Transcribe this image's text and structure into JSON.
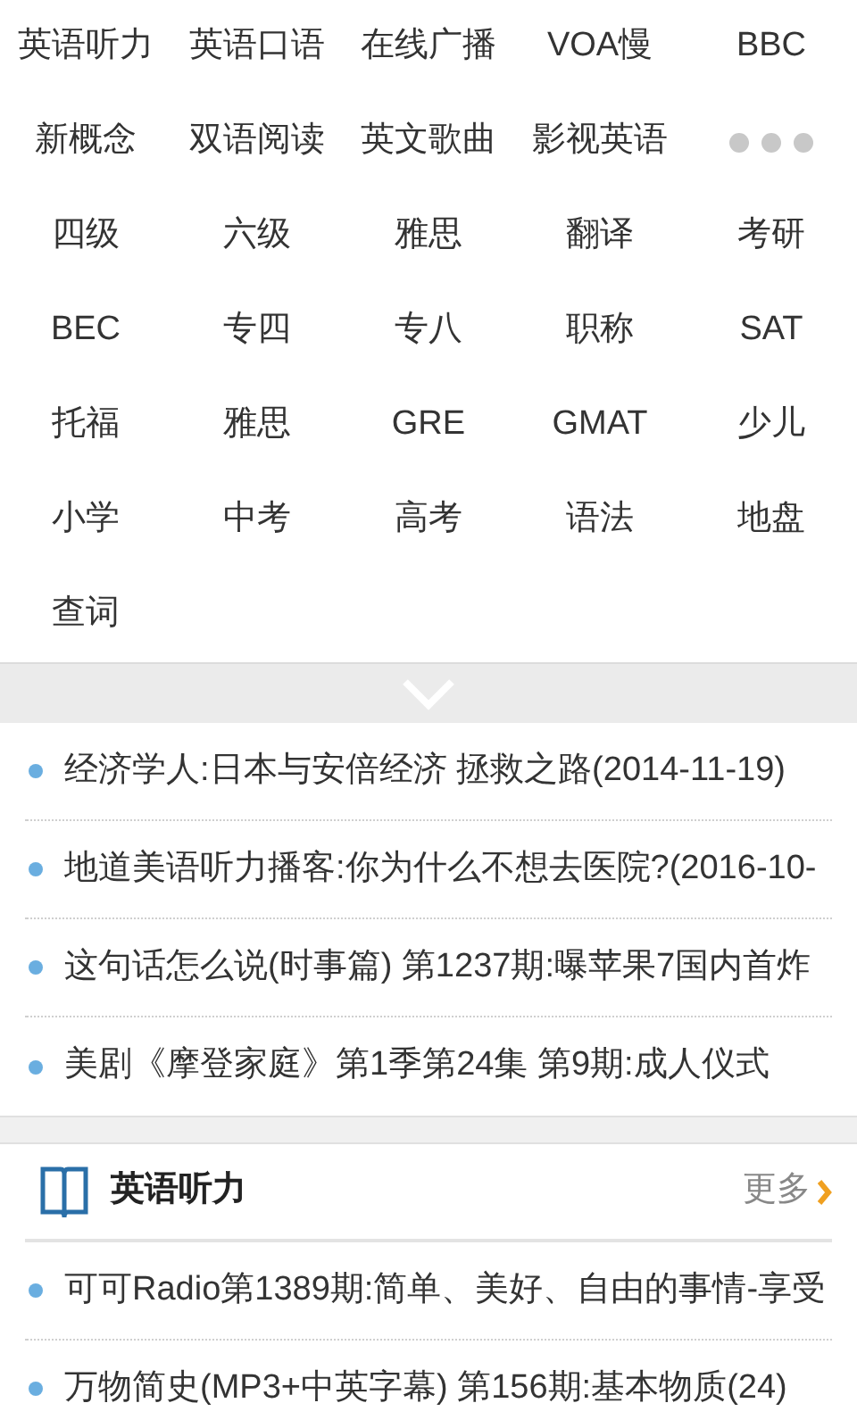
{
  "categories": [
    {
      "kind": "link",
      "label": "英语听力"
    },
    {
      "kind": "link",
      "label": "英语口语"
    },
    {
      "kind": "link",
      "label": "在线广播"
    },
    {
      "kind": "link",
      "label": "VOA慢"
    },
    {
      "kind": "link",
      "label": "BBC"
    },
    {
      "kind": "link",
      "label": "新概念"
    },
    {
      "kind": "link",
      "label": "双语阅读"
    },
    {
      "kind": "link",
      "label": "英文歌曲"
    },
    {
      "kind": "link",
      "label": "影视英语"
    },
    {
      "kind": "more"
    },
    {
      "kind": "link",
      "label": "四级"
    },
    {
      "kind": "link",
      "label": "六级"
    },
    {
      "kind": "link",
      "label": "雅思"
    },
    {
      "kind": "link",
      "label": "翻译"
    },
    {
      "kind": "link",
      "label": "考研"
    },
    {
      "kind": "link",
      "label": "BEC"
    },
    {
      "kind": "link",
      "label": "专四"
    },
    {
      "kind": "link",
      "label": "专八"
    },
    {
      "kind": "link",
      "label": "职称"
    },
    {
      "kind": "link",
      "label": "SAT"
    },
    {
      "kind": "link",
      "label": "托福"
    },
    {
      "kind": "link",
      "label": "雅思"
    },
    {
      "kind": "link",
      "label": "GRE"
    },
    {
      "kind": "link",
      "label": "GMAT"
    },
    {
      "kind": "link",
      "label": "少儿"
    },
    {
      "kind": "link",
      "label": "小学"
    },
    {
      "kind": "link",
      "label": "中考"
    },
    {
      "kind": "link",
      "label": "高考"
    },
    {
      "kind": "link",
      "label": "语法"
    },
    {
      "kind": "link",
      "label": "地盘"
    },
    {
      "kind": "link",
      "label": "查词"
    }
  ],
  "top_articles": [
    "经济学人:日本与安倍经济 拯救之路(2014-11-19)",
    "地道美语听力播客:你为什么不想去医院?(2016-10-",
    "这句话怎么说(时事篇) 第1237期:曝苹果7国内首炸",
    "美剧《摩登家庭》第1季第24集 第9期:成人仪式"
  ],
  "section": {
    "title": "英语听力",
    "more": "更多",
    "articles": [
      "可可Radio第1389期:简单、美好、自由的事情-享受",
      "万物简史(MP3+中英字幕) 第156期:基本物质(24)"
    ]
  }
}
